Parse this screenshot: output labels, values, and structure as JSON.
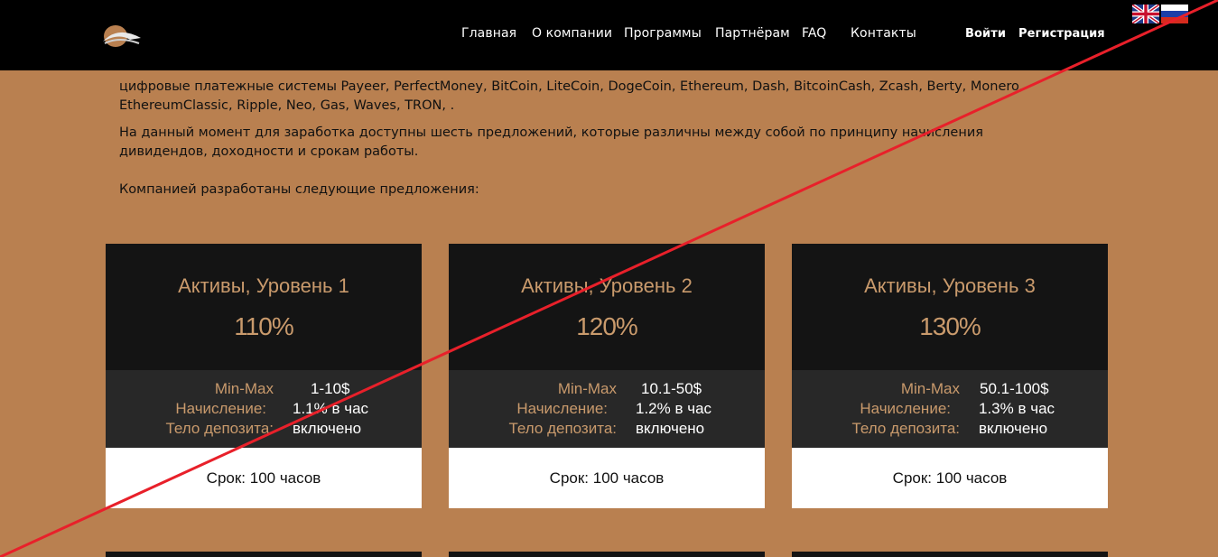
{
  "header": {
    "nav": [
      {
        "label": "Главная"
      },
      {
        "label": "О компании"
      },
      {
        "label": "Программы"
      },
      {
        "label": "Партнёрам"
      },
      {
        "label": "FAQ"
      },
      {
        "label": "Контакты"
      }
    ],
    "login_label": "Войти",
    "register_label": "Регистрация",
    "languages": [
      "english-flag-icon",
      "russian-flag-icon"
    ]
  },
  "intro": {
    "payment_systems": "цифровые платежные системы Payeer, PerfectMoney, BitCoin, LiteCoin, DogeCoin, Ethereum, Dash, BitcoinCash, Zcash, Berty, Monero, EthereumClassic, Ripple, Neo, Gas, Waves, TRON, .",
    "offers_text": "На данный момент для заработка доступны шесть предложений, которые различны между собой по принципу начисления дивидендов, доходности и срокам работы.",
    "developed_text": "Компанией разработаны следующие предложения:"
  },
  "plans": [
    {
      "title": "Активы, Уровень 1",
      "percent": "110%",
      "minmax_label": "Min-Max",
      "minmax": "1-10$",
      "accrual_label": "Начисление:",
      "accrual": "1.1% в час",
      "deposit_label": "Тело депозита:",
      "deposit": "включено",
      "term": "Срок: 100 часов"
    },
    {
      "title": "Активы, Уровень 2",
      "percent": "120%",
      "minmax_label": "Min-Max",
      "minmax": "10.1-50$",
      "accrual_label": "Начисление:",
      "accrual": "1.2% в час",
      "deposit_label": "Тело депозита:",
      "deposit": "включено",
      "term": "Срок: 100 часов"
    },
    {
      "title": "Активы, Уровень 3",
      "percent": "130%",
      "minmax_label": "Min-Max",
      "minmax": "50.1-100$",
      "accrual_label": "Начисление:",
      "accrual": "1.3% в час",
      "deposit_label": "Тело депозита:",
      "deposit": "включено",
      "term": "Срок: 100 часов"
    }
  ],
  "colors": {
    "page_bg": "#b98050",
    "header_bg": "#000000",
    "card_top": "#141414",
    "card_mid": "#282828",
    "accent": "#c99a6c",
    "strike_line": "#e8202a"
  }
}
